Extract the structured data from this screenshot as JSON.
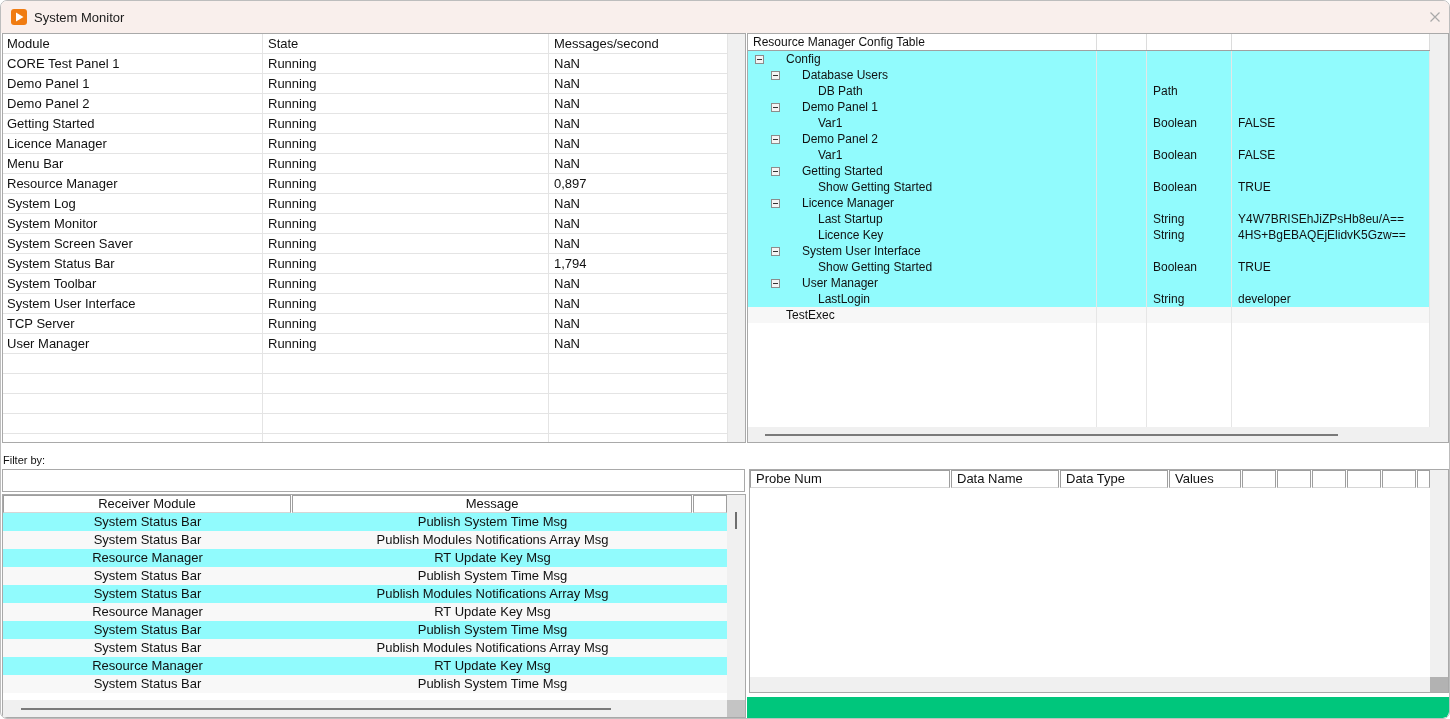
{
  "window": {
    "title": "System Monitor"
  },
  "modules_table": {
    "columns": [
      "Module",
      "State",
      "Messages/second"
    ],
    "rows": [
      [
        "CORE Test Panel 1",
        "Running",
        "NaN"
      ],
      [
        "Demo Panel 1",
        "Running",
        "NaN"
      ],
      [
        "Demo Panel 2",
        "Running",
        "NaN"
      ],
      [
        "Getting Started",
        "Running",
        "NaN"
      ],
      [
        "Licence Manager",
        "Running",
        "NaN"
      ],
      [
        "Menu Bar",
        "Running",
        "NaN"
      ],
      [
        "Resource Manager",
        "Running",
        "0,897"
      ],
      [
        "System Log",
        "Running",
        "NaN"
      ],
      [
        "System Monitor",
        "Running",
        "NaN"
      ],
      [
        "System Screen Saver",
        "Running",
        "NaN"
      ],
      [
        "System Status Bar",
        "Running",
        "1,794"
      ],
      [
        "System Toolbar",
        "Running",
        "NaN"
      ],
      [
        "System User Interface",
        "Running",
        "NaN"
      ],
      [
        "TCP Server",
        "Running",
        "NaN"
      ],
      [
        "User Manager",
        "Running",
        "NaN"
      ]
    ]
  },
  "config_table": {
    "title": "Resource Manager Config Table",
    "nodes": [
      {
        "label": "Config",
        "selected": true,
        "expanded": true,
        "children": [
          {
            "label": "Database Users",
            "selected": true,
            "expanded": true,
            "children": [
              {
                "label": "DB Path",
                "column_3": "Path",
                "selected": true
              }
            ]
          },
          {
            "label": "Demo Panel 1",
            "selected": true,
            "expanded": true,
            "children": [
              {
                "label": "Var1",
                "column_3": "Boolean",
                "column_4": "FALSE",
                "selected": true
              }
            ]
          },
          {
            "label": "Demo Panel 2",
            "selected": true,
            "expanded": true,
            "children": [
              {
                "label": "Var1",
                "column_3": "Boolean",
                "column_4": "FALSE",
                "selected": true
              }
            ]
          },
          {
            "label": "Getting Started",
            "selected": true,
            "expanded": true,
            "children": [
              {
                "label": "Show Getting Started",
                "column_3": "Boolean",
                "column_4": "TRUE",
                "selected": true
              }
            ]
          },
          {
            "label": "Licence Manager",
            "selected": true,
            "expanded": true,
            "children": [
              {
                "label": "Last Startup",
                "column_3": "String",
                "column_4": "Y4W7BRISEhJiZPsHb8eu/A==",
                "selected": true
              },
              {
                "label": "Licence Key",
                "column_3": "String",
                "column_4": "4HS+BgEBAQEjElidvK5Gzw==",
                "selected": true
              }
            ]
          },
          {
            "label": "System User Interface",
            "selected": true,
            "expanded": true,
            "children": [
              {
                "label": "Show Getting Started",
                "column_3": "Boolean",
                "column_4": "TRUE",
                "selected": true
              }
            ]
          },
          {
            "label": "User Manager",
            "selected": true,
            "expanded": true,
            "children": [
              {
                "label": "LastLogin",
                "column_3": "String",
                "column_4": "developer",
                "selected": true
              }
            ]
          }
        ]
      },
      {
        "label": "TestExec",
        "selected": false
      }
    ]
  },
  "filter": {
    "label": "Filter by:"
  },
  "messages_table": {
    "columns": [
      "Receiver Module",
      "Message"
    ],
    "rows": [
      [
        "System Status Bar",
        "Publish System Time Msg"
      ],
      [
        "System Status Bar",
        "Publish Modules Notifications Array Msg"
      ],
      [
        "Resource Manager",
        "RT Update Key Msg"
      ],
      [
        "System Status Bar",
        "Publish System Time Msg"
      ],
      [
        "System Status Bar",
        "Publish Modules Notifications Array Msg"
      ],
      [
        "Resource Manager",
        "RT Update Key Msg"
      ],
      [
        "System Status Bar",
        "Publish System Time Msg"
      ],
      [
        "System Status Bar",
        "Publish Modules Notifications Array Msg"
      ],
      [
        "Resource Manager",
        "RT Update Key Msg"
      ],
      [
        "System Status Bar",
        "Publish System Time Msg"
      ]
    ]
  },
  "probe_table": {
    "columns": [
      "Probe Num",
      "Data Name",
      "Data Type",
      "Values"
    ]
  }
}
